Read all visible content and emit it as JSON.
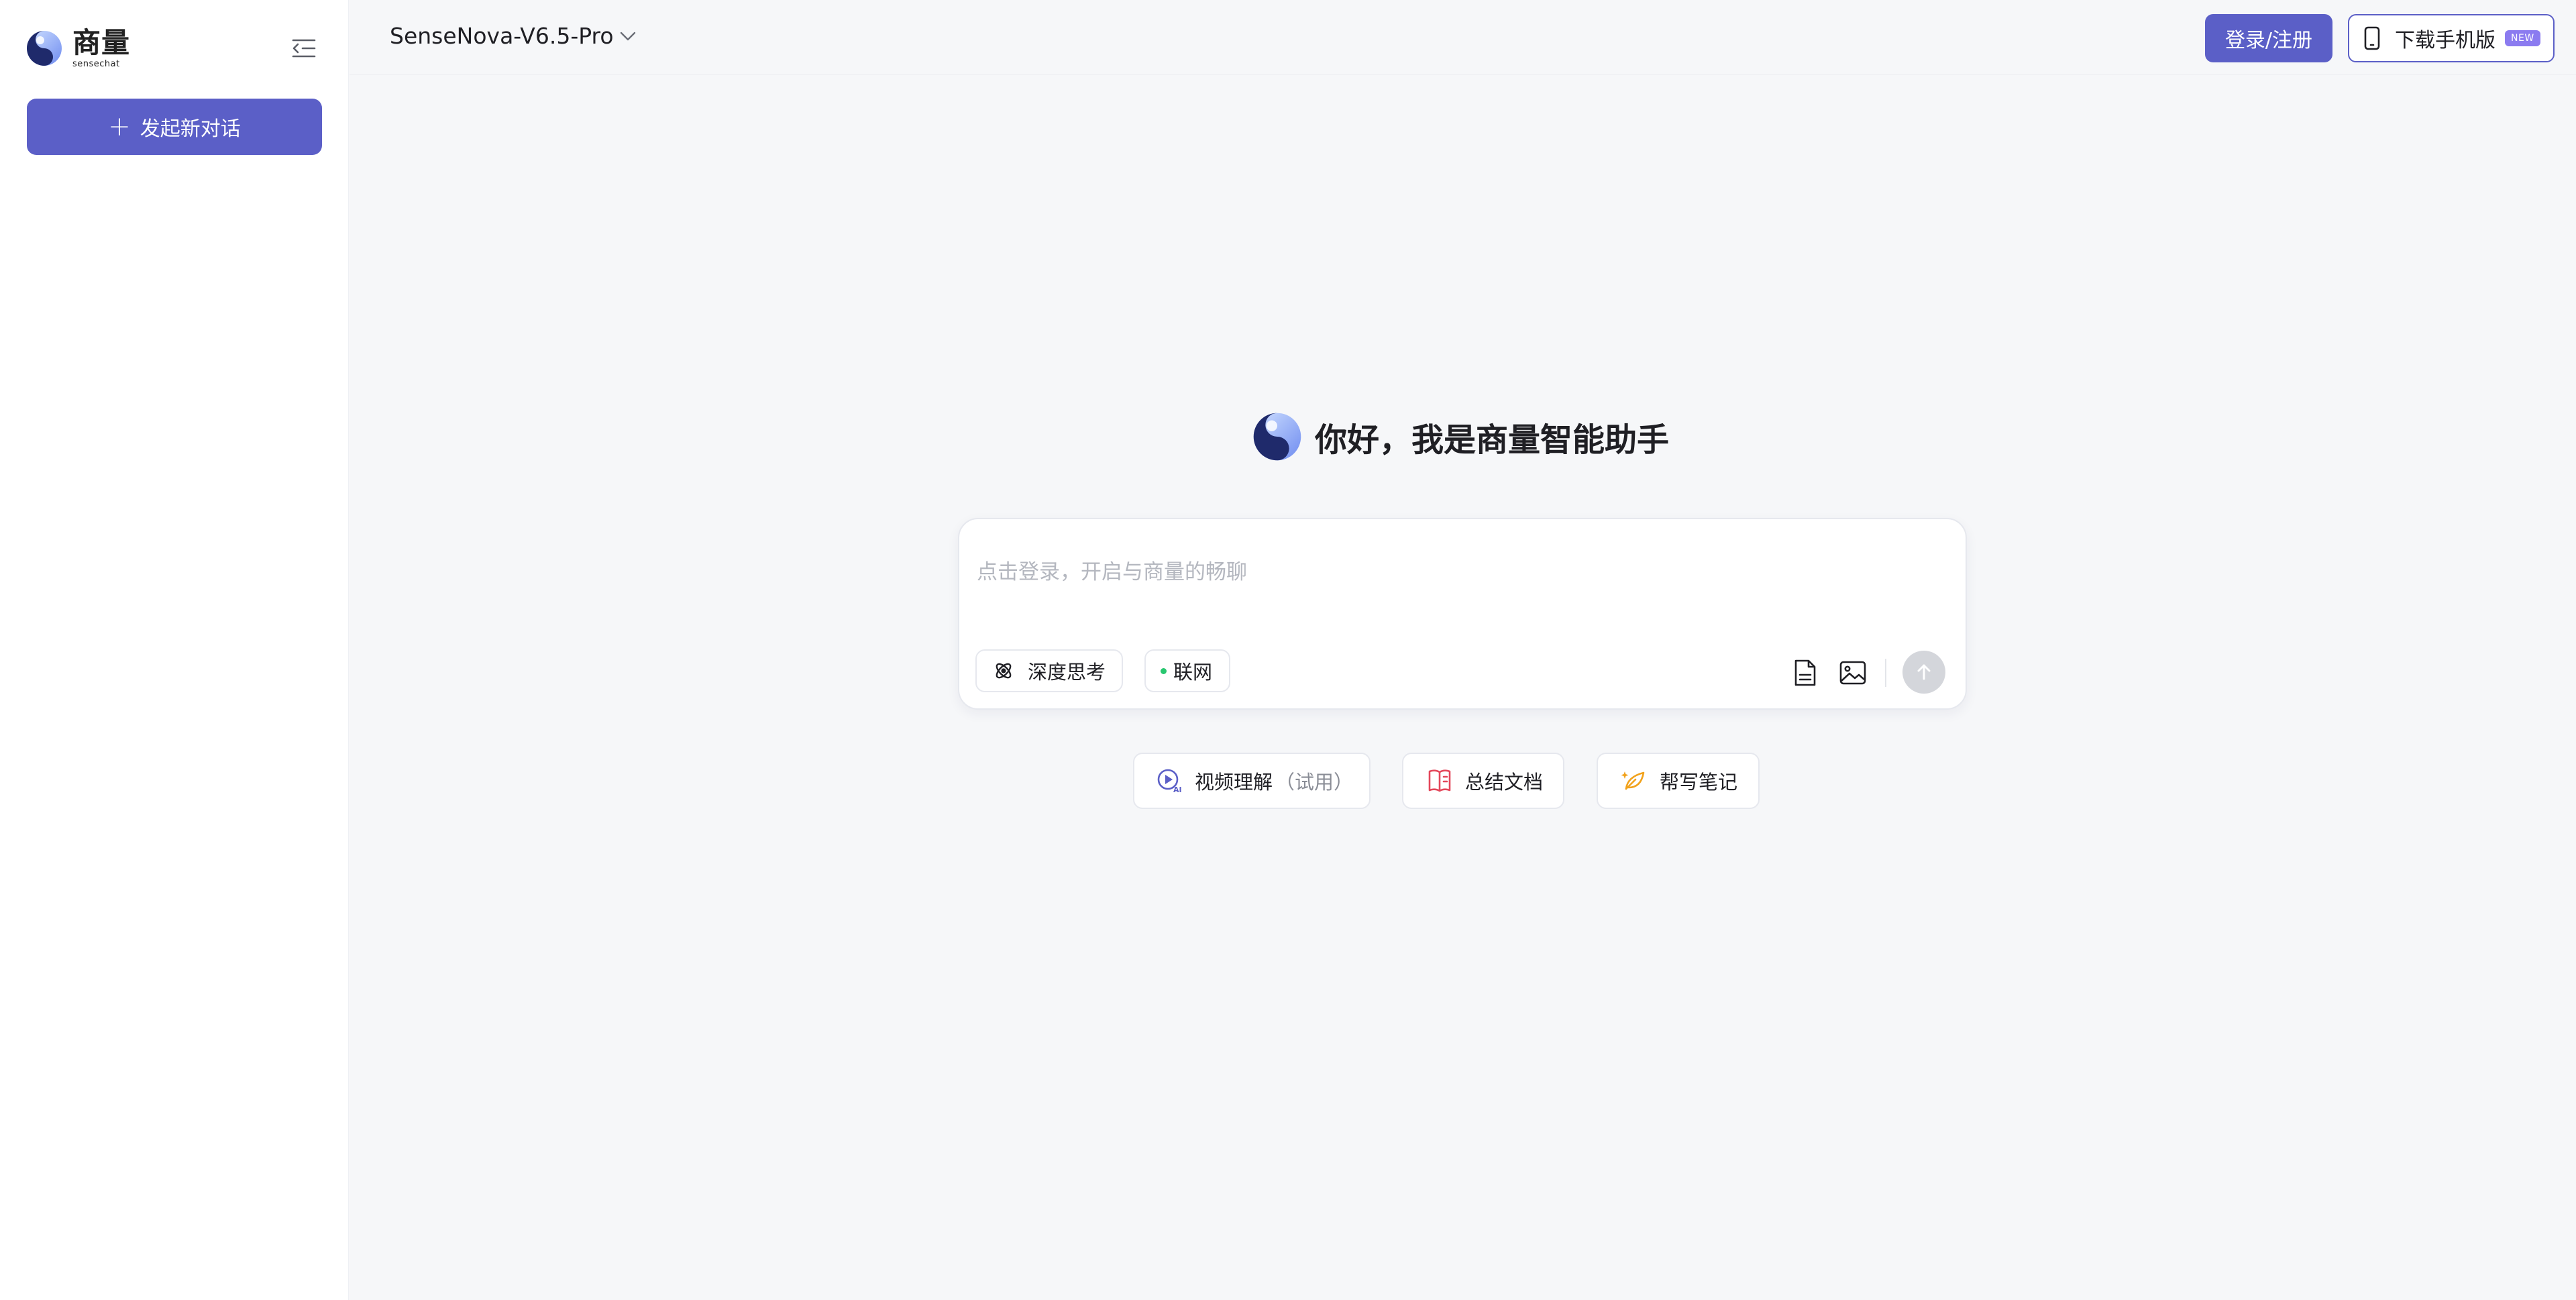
{
  "sidebar": {
    "logo": {
      "cn": "商量",
      "en": "sensechat"
    },
    "new_chat_label": "发起新对话"
  },
  "header": {
    "model_name": "SenseNova-V6.5-Pro",
    "login_label": "登录/注册",
    "download_label": "下载手机版",
    "new_badge": "NEW"
  },
  "main": {
    "greeting": "你好，我是商量智能助手",
    "input_placeholder": "点击登录，开启与商量的畅聊",
    "chips": {
      "deep_think": "深度思考",
      "web": "联网"
    },
    "suggestions": {
      "video": "视频理解",
      "video_note": "（试用）",
      "summarize": "总结文档",
      "notes": "帮写笔记"
    }
  },
  "colors": {
    "accent": "#5b5fc7",
    "badge": "#8b7bf0",
    "web_dot": "#28c76f",
    "page_bg": "#f6f7f9",
    "send_disabled": "#d4d6db"
  },
  "icons": [
    "logo-icon",
    "collapse-sidebar-icon",
    "chevron-down-icon",
    "phone-icon",
    "brain-icon",
    "document-icon",
    "image-icon",
    "arrow-up-icon",
    "video-ai-icon",
    "book-icon",
    "leaf-pen-icon"
  ]
}
